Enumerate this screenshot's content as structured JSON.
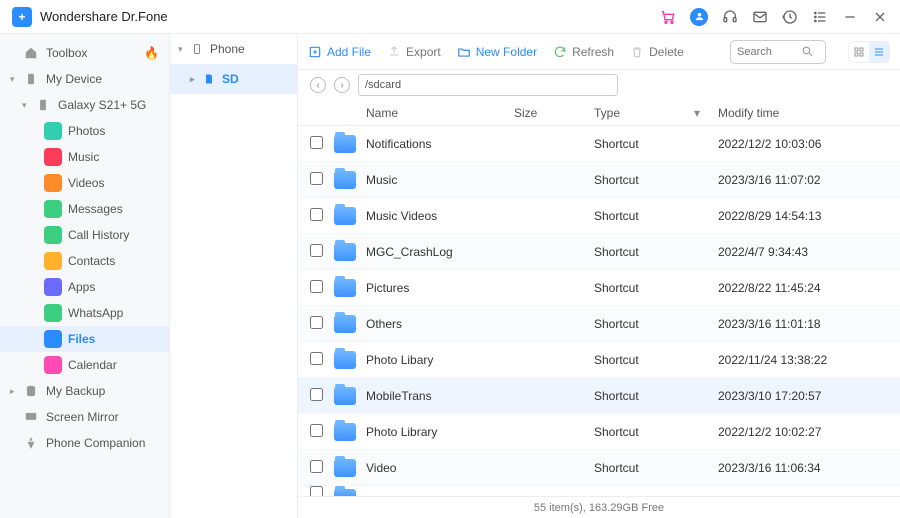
{
  "title": "Wondershare Dr.Fone",
  "sidebar": {
    "toolbox": "Toolbox",
    "mydevice": "My Device",
    "device": "Galaxy S21+ 5G",
    "items": [
      "Photos",
      "Music",
      "Videos",
      "Messages",
      "Call History",
      "Contacts",
      "Apps",
      "WhatsApp",
      "Files",
      "Calendar"
    ],
    "mybackup": "My Backup",
    "screenmirror": "Screen Mirror",
    "companion": "Phone Companion"
  },
  "middle": {
    "phone": "Phone",
    "sd": "SD"
  },
  "toolbar": {
    "addfile": "Add File",
    "export": "Export",
    "newfolder": "New Folder",
    "refresh": "Refresh",
    "delete": "Delete",
    "search_ph": "Search"
  },
  "path": "/sdcard",
  "columns": {
    "name": "Name",
    "size": "Size",
    "type": "Type",
    "time": "Modify time"
  },
  "rows": [
    {
      "name": "Notifications",
      "type": "Shortcut",
      "time": "2022/12/2 10:03:06"
    },
    {
      "name": "Music",
      "type": "Shortcut",
      "time": "2023/3/16 11:07:02"
    },
    {
      "name": "Music Videos",
      "type": "Shortcut",
      "time": "2022/8/29 14:54:13"
    },
    {
      "name": "MGC_CrashLog",
      "type": "Shortcut",
      "time": "2022/4/7 9:34:43"
    },
    {
      "name": "Pictures",
      "type": "Shortcut",
      "time": "2022/8/22 11:45:24"
    },
    {
      "name": "Others",
      "type": "Shortcut",
      "time": "2023/3/16 11:01:18"
    },
    {
      "name": "Photo Libary",
      "type": "Shortcut",
      "time": "2022/11/24 13:38:22"
    },
    {
      "name": "MobileTrans",
      "type": "Shortcut",
      "time": "2023/3/10 17:20:57",
      "hl": true
    },
    {
      "name": "Photo Library",
      "type": "Shortcut",
      "time": "2022/12/2 10:02:27"
    },
    {
      "name": "Video",
      "type": "Shortcut",
      "time": "2023/3/16 11:06:34"
    }
  ],
  "status": "55 item(s), 163.29GB Free",
  "icon_colors": [
    "#31cfb0",
    "#ff3b5c",
    "#ff8a2a",
    "#3bcf7f",
    "#3bcf7f",
    "#ffb12a",
    "#6a6bff",
    "#3bcf7f",
    "#2b8cff",
    "#ff4bb3"
  ]
}
